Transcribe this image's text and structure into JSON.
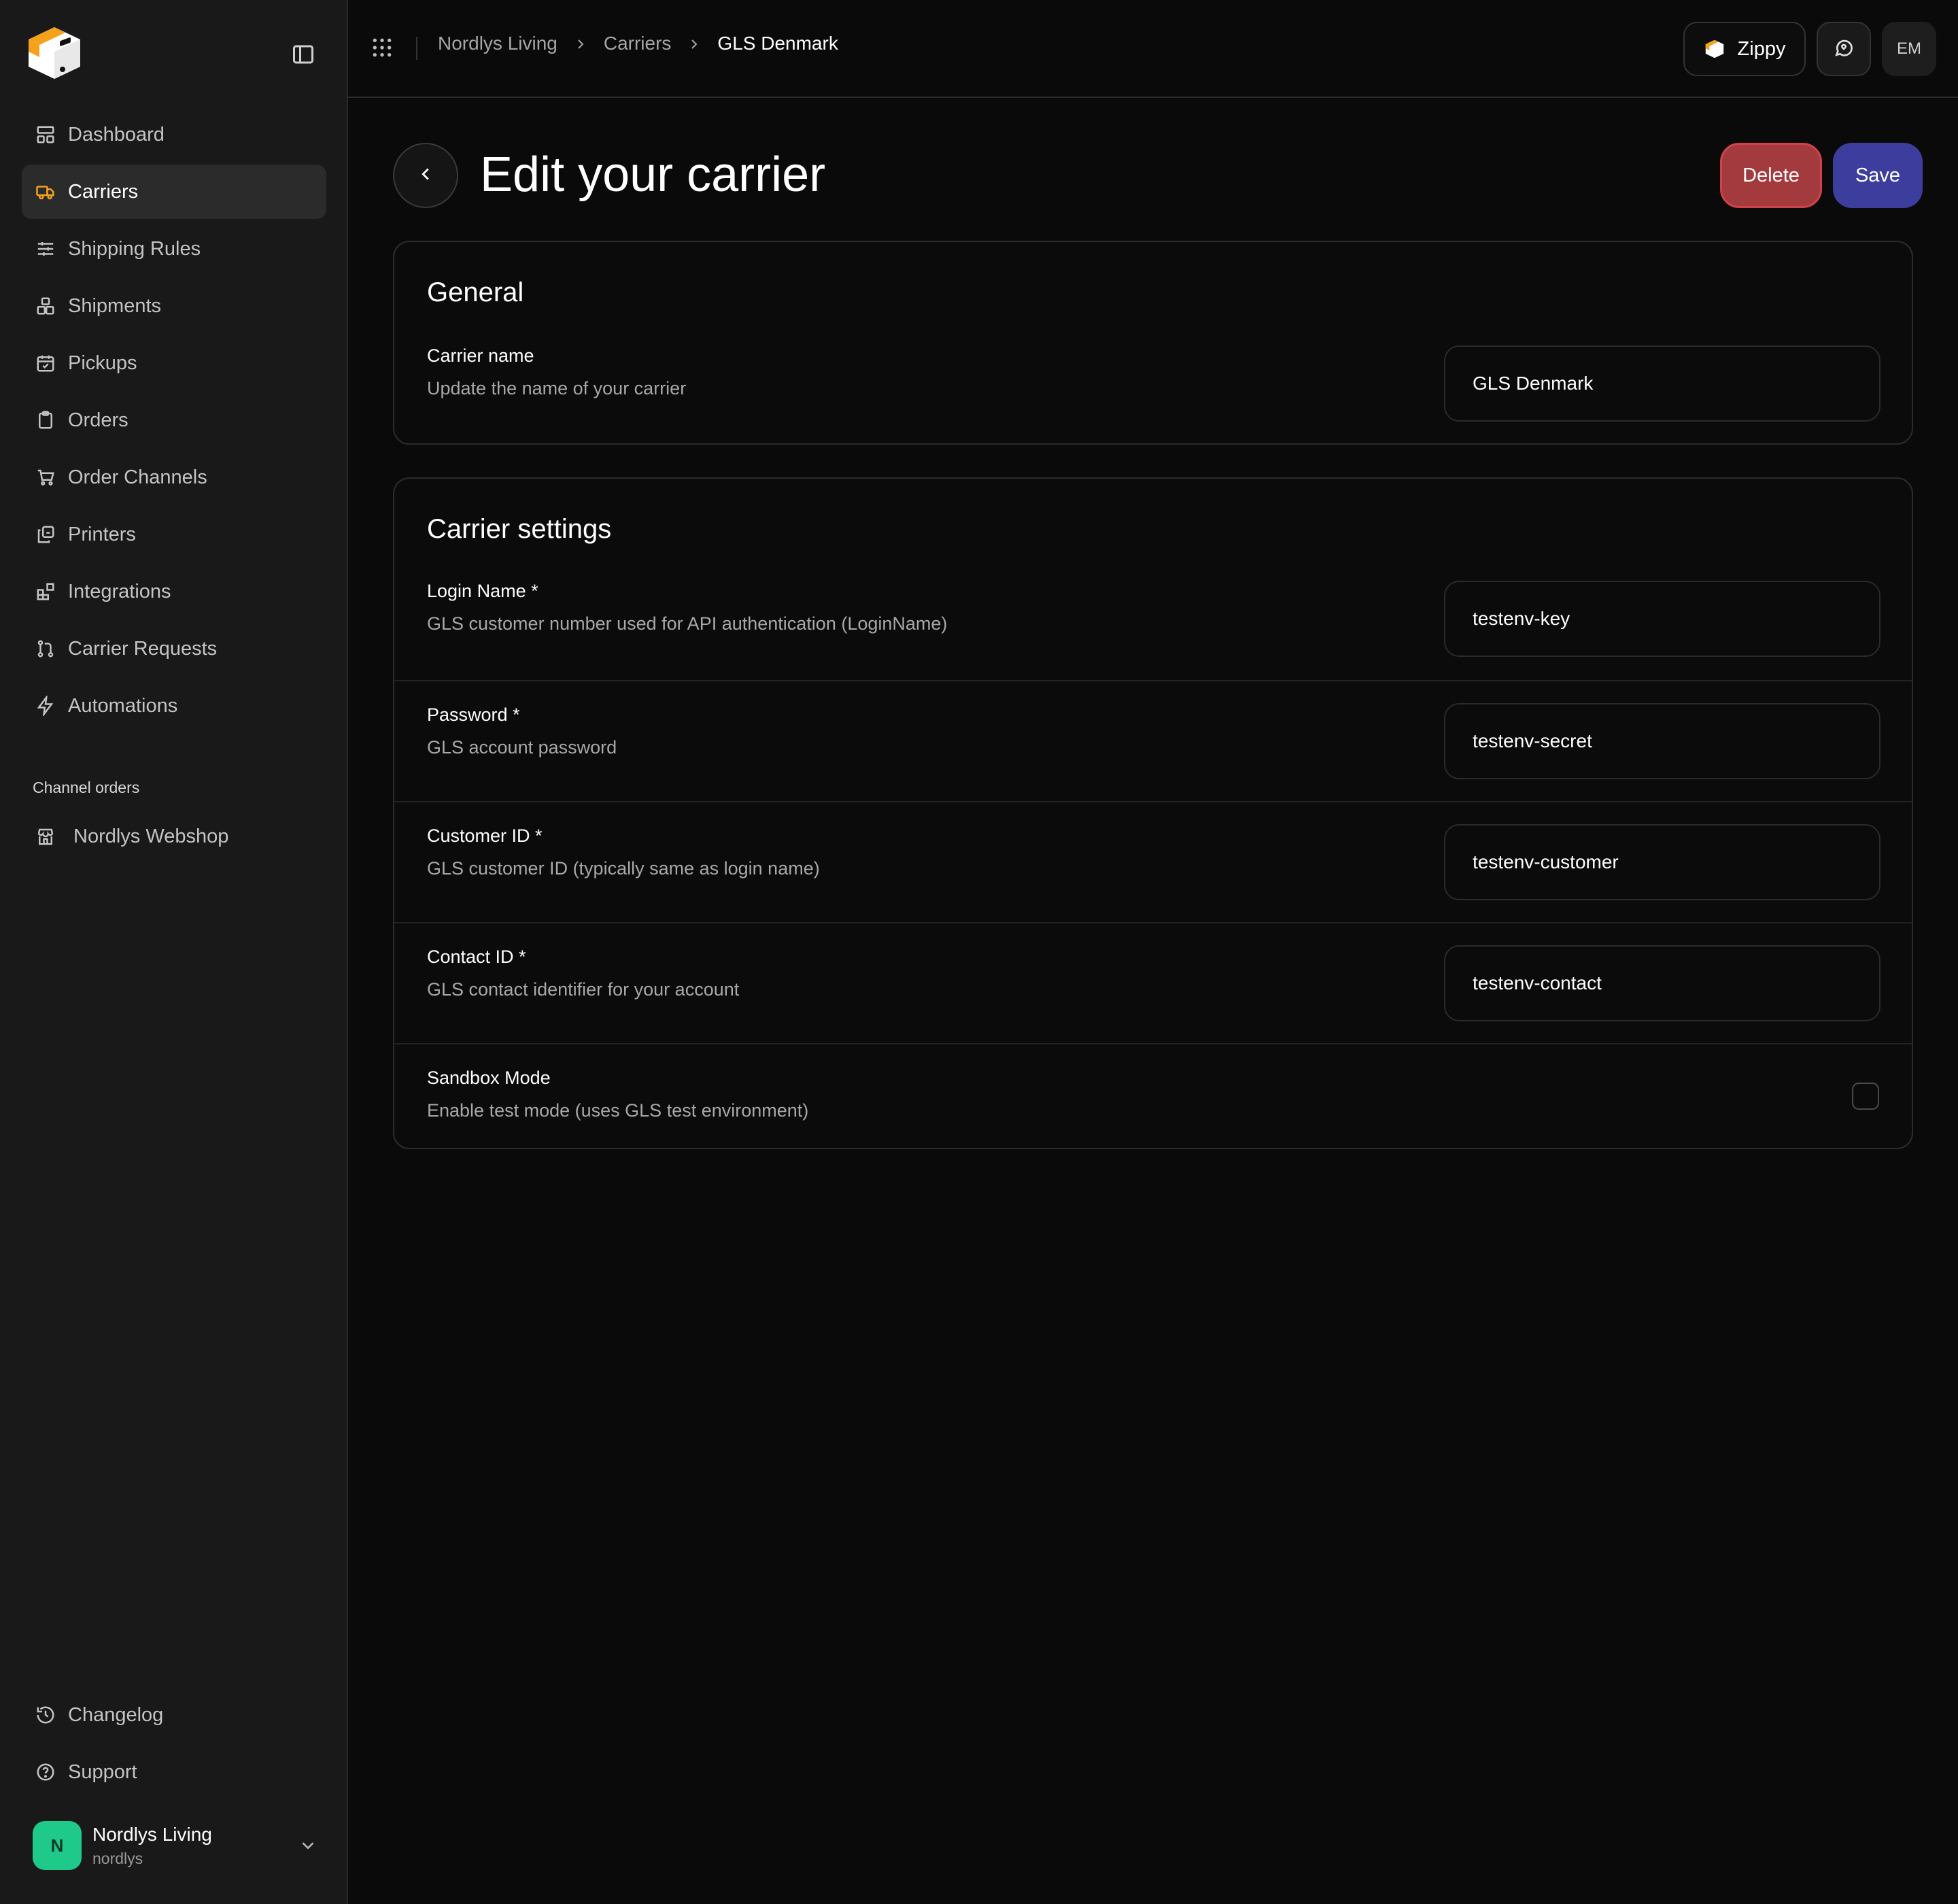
{
  "sidebar": {
    "nav": [
      {
        "label": "Dashboard",
        "icon": "layout-dashboard-icon",
        "active": false
      },
      {
        "label": "Carriers",
        "icon": "truck-icon",
        "active": true
      },
      {
        "label": "Shipping Rules",
        "icon": "sliders-icon",
        "active": false
      },
      {
        "label": "Shipments",
        "icon": "boxes-icon",
        "active": false
      },
      {
        "label": "Pickups",
        "icon": "calendar-check-icon",
        "active": false
      },
      {
        "label": "Orders",
        "icon": "clipboard-icon",
        "active": false
      },
      {
        "label": "Order Channels",
        "icon": "shopping-cart-icon",
        "active": false
      },
      {
        "label": "Printers",
        "icon": "printer-icon",
        "active": false
      },
      {
        "label": "Integrations",
        "icon": "blocks-icon",
        "active": false
      },
      {
        "label": "Carrier Requests",
        "icon": "git-pull-request-icon",
        "active": false
      },
      {
        "label": "Automations",
        "icon": "zap-icon",
        "active": false
      }
    ],
    "channel_section_label": "Channel orders",
    "channels": [
      {
        "label": "Nordlys Webshop",
        "icon": "store-icon"
      }
    ],
    "bottom": [
      {
        "label": "Changelog",
        "icon": "history-icon"
      },
      {
        "label": "Support",
        "icon": "help-circle-icon"
      }
    ],
    "org": {
      "initial": "N",
      "name": "Nordlys Living",
      "handle": "nordlys"
    }
  },
  "topbar": {
    "breadcrumb": [
      "Nordlys Living",
      "Carriers",
      "GLS Denmark"
    ],
    "zippy_label": "Zippy",
    "user_initials": "EM"
  },
  "page": {
    "title": "Edit your carrier",
    "delete_label": "Delete",
    "save_label": "Save"
  },
  "general": {
    "title": "General",
    "carrier_name": {
      "label": "Carrier name",
      "description": "Update the name of your carrier",
      "value": "GLS Denmark"
    }
  },
  "settings": {
    "title": "Carrier settings",
    "fields": [
      {
        "label": "Login Name *",
        "description": "GLS customer number used for API authentication (LoginName)",
        "value": "testenv-key"
      },
      {
        "label": "Password *",
        "description": "GLS account password",
        "value": "testenv-secret"
      },
      {
        "label": "Customer ID *",
        "description": "GLS customer ID (typically same as login name)",
        "value": "testenv-customer"
      },
      {
        "label": "Contact ID *",
        "description": "GLS contact identifier for your account",
        "value": "testenv-contact"
      }
    ],
    "sandbox": {
      "label": "Sandbox Mode",
      "description": "Enable test mode (uses GLS test environment)",
      "checked": false
    }
  },
  "colors": {
    "accent_orange": "#f5a21a",
    "delete_red": "#a23a3e",
    "save_blue": "#3d3d9e",
    "org_green": "#1fc98a"
  }
}
